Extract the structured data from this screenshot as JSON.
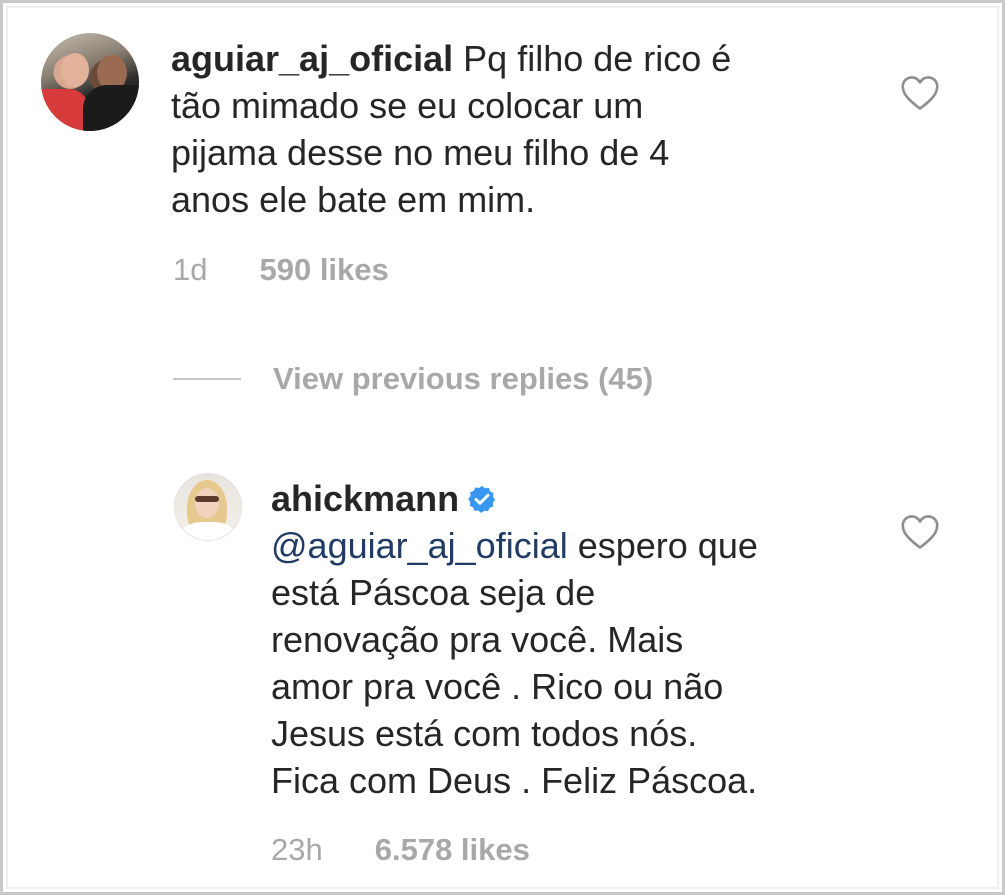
{
  "comments": [
    {
      "username": "aguiar_aj_oficial",
      "text": " Pq filho de rico é tão mimado se eu colocar um pijama desse no meu filho de 4 anos ele bate em mim.",
      "lines": [
        "Pq filho de rico é",
        "tão mimado se eu colocar um",
        "pijama desse no meu filho de 4",
        "anos ele bate em mim."
      ],
      "time": "1d",
      "likes": "590 likes"
    },
    {
      "username": "ahickmann",
      "verified": true,
      "mention": "@aguiar_aj_oficial",
      "lines": [
        " espero que",
        "está Páscoa seja de",
        "renovação pra você. Mais",
        "amor pra você . Rico ou não",
        "Jesus está com todos nós.",
        "Fica com Deus . Feliz Páscoa."
      ],
      "time": "23h",
      "likes": "6.578 likes"
    }
  ],
  "replies": {
    "view_previous": "View previous replies (45)"
  },
  "icons": {
    "heart": "heart-outline-icon",
    "verified": "verified-badge-icon"
  },
  "colors": {
    "text": "#262626",
    "muted": "#a8a8a8",
    "verified": "#3897f0",
    "mention": "#1f3b66"
  }
}
